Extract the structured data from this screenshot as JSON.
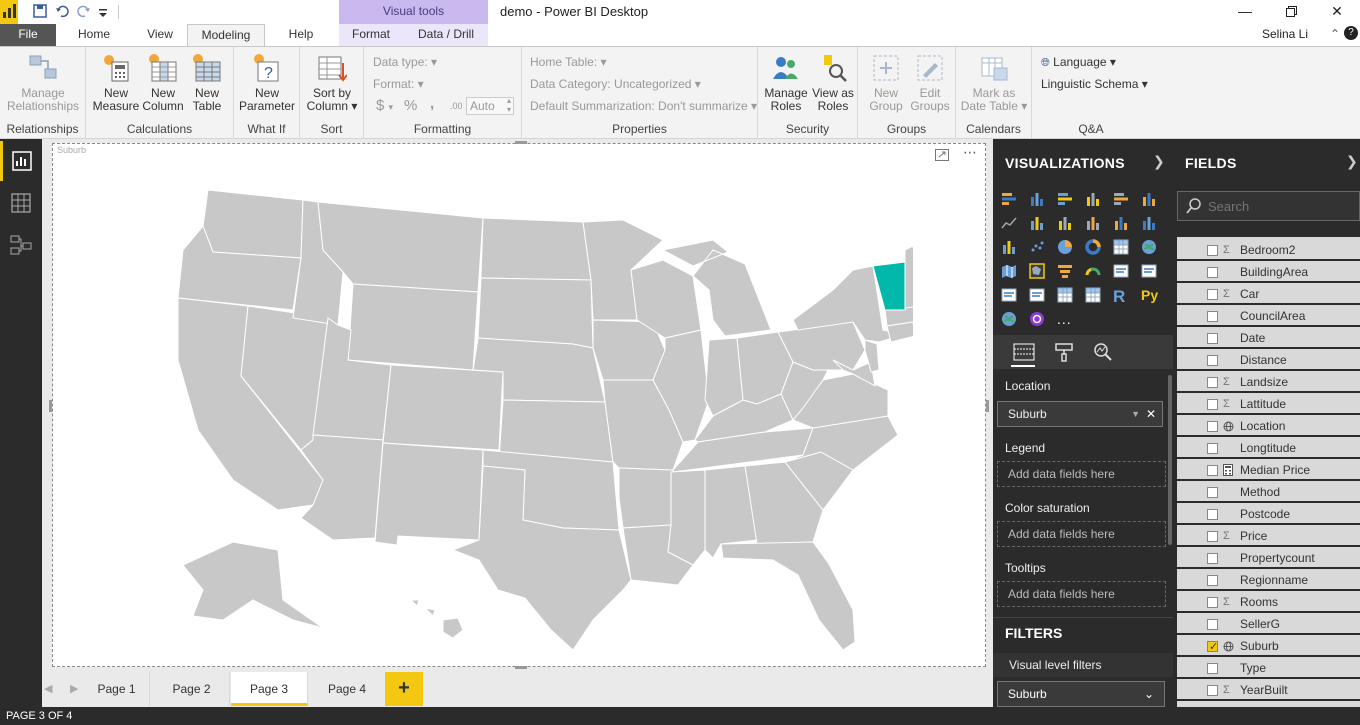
{
  "app": {
    "title": "demo - Power BI Desktop",
    "user": "Selina Li",
    "visual_tools": "Visual tools"
  },
  "tabs": [
    {
      "label": "File"
    },
    {
      "label": "Home"
    },
    {
      "label": "View"
    },
    {
      "label": "Modeling"
    },
    {
      "label": "Help"
    },
    {
      "label": "Format"
    },
    {
      "label": "Data / Drill"
    }
  ],
  "ribbon": {
    "relationships": {
      "btn1": "Manage",
      "btn2": "Relationships",
      "group": "Relationships"
    },
    "calculations": {
      "m1": "New",
      "m2": "Measure",
      "c1": "New",
      "c2": "Column",
      "t1": "New",
      "t2": "Table",
      "group": "Calculations"
    },
    "whatif": {
      "p1": "New",
      "p2": "Parameter",
      "group": "What If"
    },
    "sort": {
      "s1": "Sort by",
      "s2": "Column",
      "group": "Sort"
    },
    "formatting": {
      "datatype": "Data type:",
      "format": "Format:",
      "dollar": "$",
      "percent": "%",
      "comma": ",",
      "decimals": ".00",
      "auto": "Auto",
      "group": "Formatting"
    },
    "properties": {
      "home_table": "Home Table:",
      "category": "Data Category: Uncategorized",
      "summarization": "Default Summarization: Don't summarize",
      "group": "Properties"
    },
    "security": {
      "r1": "Manage",
      "r2": "Roles",
      "v1": "View as",
      "v2": "Roles",
      "group": "Security"
    },
    "groups": {
      "n1": "New",
      "n2": "Group",
      "e1": "Edit",
      "e2": "Groups",
      "group": "Groups"
    },
    "calendars": {
      "m1": "Mark as",
      "m2": "Date Table",
      "group": "Calendars"
    },
    "qa": {
      "language": "Language",
      "schema": "Linguistic Schema",
      "group": "Q&A"
    }
  },
  "visual": {
    "title": "Suburb",
    "highlight_color": "#01b8aa",
    "map_fill": "#c8c8c8"
  },
  "pages": {
    "tabs": [
      "Page 1",
      "Page 2",
      "Page 3",
      "Page 4"
    ],
    "active": "Page 3",
    "add": "+",
    "status": "PAGE 3 OF 4"
  },
  "visualizations": {
    "header": "VISUALIZATIONS",
    "wells": [
      {
        "label": "Location",
        "value": "Suburb"
      },
      {
        "label": "Legend",
        "value": "Add data fields here"
      },
      {
        "label": "Color saturation",
        "value": "Add data fields here"
      },
      {
        "label": "Tooltips",
        "value": "Add data fields here"
      }
    ],
    "filters_header": "FILTERS",
    "filters_sub": "Visual level filters",
    "filter_value": "Suburb",
    "py": "Py",
    "r": "R",
    "more": "..."
  },
  "fields": {
    "header": "FIELDS",
    "search_placeholder": "Search",
    "items": [
      {
        "name": "Bedroom2",
        "sigma": true,
        "checked": false
      },
      {
        "name": "BuildingArea",
        "sigma": false,
        "checked": false
      },
      {
        "name": "Car",
        "sigma": true,
        "checked": false
      },
      {
        "name": "CouncilArea",
        "sigma": false,
        "checked": false
      },
      {
        "name": "Date",
        "sigma": false,
        "checked": false
      },
      {
        "name": "Distance",
        "sigma": false,
        "checked": false
      },
      {
        "name": "Landsize",
        "sigma": true,
        "checked": false
      },
      {
        "name": "Lattitude",
        "sigma": true,
        "checked": false
      },
      {
        "name": "Location",
        "globe": true,
        "checked": false
      },
      {
        "name": "Longtitude",
        "sigma": false,
        "checked": false
      },
      {
        "name": "Median Price",
        "calc": true,
        "checked": false
      },
      {
        "name": "Method",
        "sigma": false,
        "checked": false
      },
      {
        "name": "Postcode",
        "sigma": false,
        "checked": false
      },
      {
        "name": "Price",
        "sigma": true,
        "checked": false
      },
      {
        "name": "Propertycount",
        "sigma": false,
        "checked": false
      },
      {
        "name": "Regionname",
        "sigma": false,
        "checked": false
      },
      {
        "name": "Rooms",
        "sigma": true,
        "checked": false
      },
      {
        "name": "SellerG",
        "sigma": false,
        "checked": false
      },
      {
        "name": "Suburb",
        "globe": true,
        "checked": true
      },
      {
        "name": "Type",
        "sigma": false,
        "checked": false
      },
      {
        "name": "YearBuilt",
        "sigma": true,
        "checked": false
      }
    ]
  }
}
